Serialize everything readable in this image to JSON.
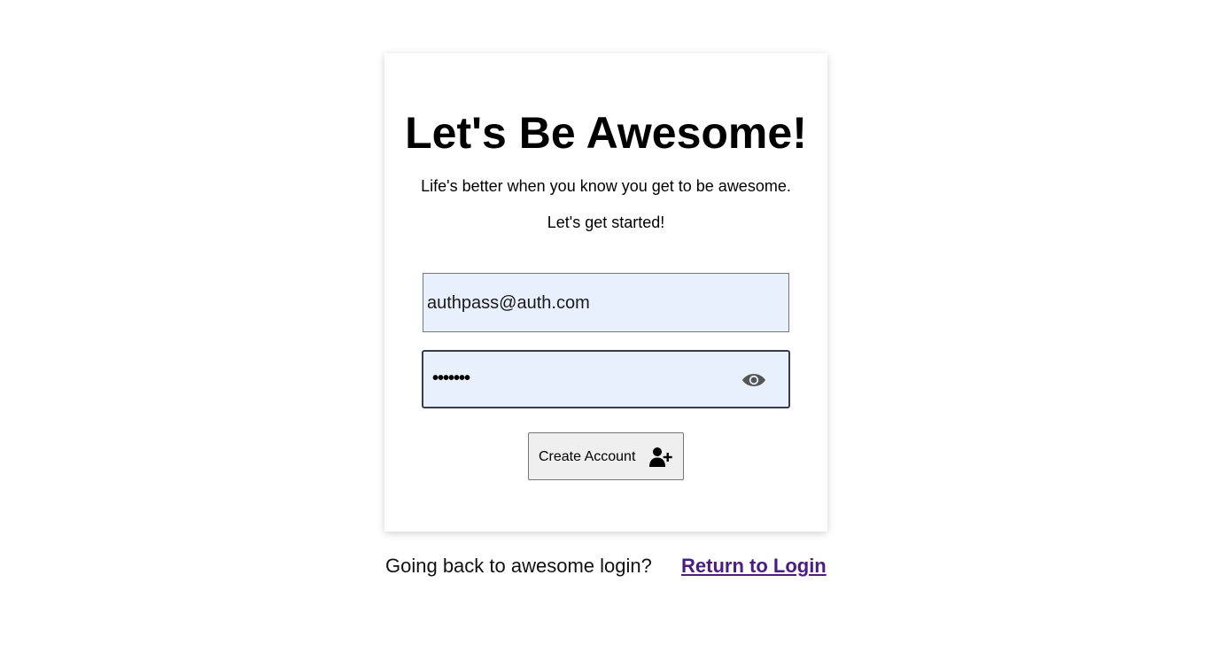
{
  "signup": {
    "title": "Let's Be Awesome!",
    "subtitle": "Life's better when you know you get to be awesome.",
    "cta_text": "Let's get started!",
    "email_value": "authpass@auth.com",
    "password_value": "•••••••",
    "password_toggle_icon": "eye-icon",
    "create_button_label": "Create Account",
    "create_button_icon": "add-user-icon"
  },
  "footer": {
    "prompt": "Going back to awesome login?",
    "link_label": "Return to Login"
  },
  "colors": {
    "input_background": "#e8f0fe",
    "link": "#4b1c82",
    "button_background": "#efefef"
  }
}
